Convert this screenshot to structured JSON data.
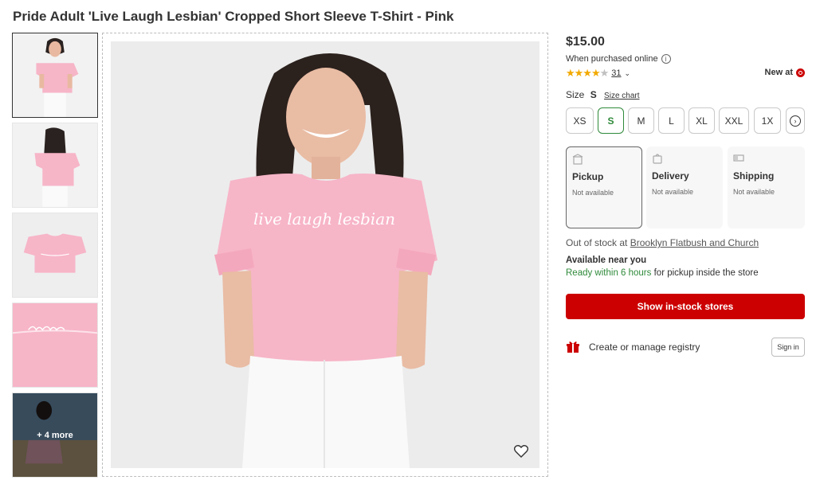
{
  "product": {
    "title": "Pride Adult 'Live Laugh Lesbian' Cropped Short Sleeve T-Shirt - Pink",
    "shirt_print": "live laugh lesbian",
    "price": "$15.00",
    "price_note": "When purchased online",
    "rating": {
      "stars": 4,
      "max": 5,
      "count": "31"
    },
    "new_at": "New at"
  },
  "gallery": {
    "more_label": "+ 4 more"
  },
  "size": {
    "label": "Size",
    "selected": "S",
    "chart_link": "Size chart",
    "options": [
      "XS",
      "S",
      "M",
      "L",
      "XL",
      "XXL",
      "1X"
    ]
  },
  "fulfillment": [
    {
      "name": "Pickup",
      "status": "Not available",
      "icon": "store-icon"
    },
    {
      "name": "Delivery",
      "status": "Not available",
      "icon": "bag-icon"
    },
    {
      "name": "Shipping",
      "status": "Not available",
      "icon": "truck-icon"
    }
  ],
  "stock": {
    "prefix": "Out of stock at",
    "store": "Brooklyn Flatbush and Church",
    "available_title": "Available near you",
    "ready_text": "Ready within 6 hours",
    "ready_suffix": "for pickup inside the store"
  },
  "cta": {
    "label": "Show in-stock stores"
  },
  "registry": {
    "label": "Create or manage registry",
    "sign_in": "Sign in"
  },
  "colors": {
    "brand_red": "#cc0000",
    "selected_green": "#2f8a3a",
    "shirt_pink": "#f7b5c8"
  }
}
